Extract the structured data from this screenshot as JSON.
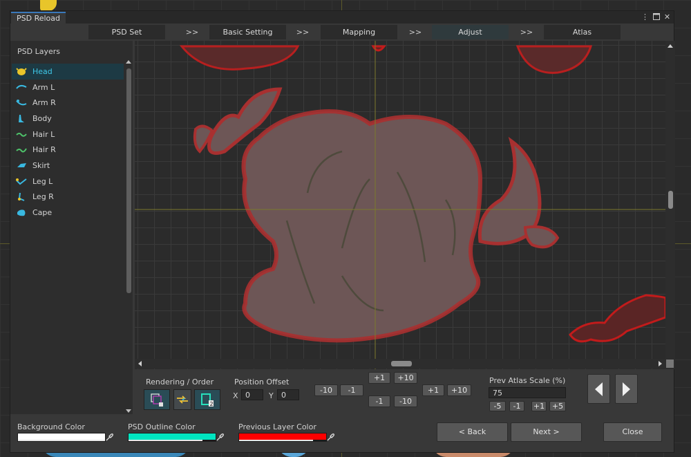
{
  "window": {
    "title": "PSD Reload"
  },
  "steps": [
    {
      "label": "PSD Set"
    },
    {
      "label": "Basic Setting"
    },
    {
      "label": "Mapping"
    },
    {
      "label": "Adjust",
      "active": true
    },
    {
      "label": "Atlas"
    }
  ],
  "step_separator": ">>",
  "layers_panel": {
    "title": "PSD Layers",
    "selected": "Head",
    "items": [
      {
        "label": "Head",
        "icon": "head-layer-icon",
        "color": "#e8c52a"
      },
      {
        "label": "Arm L",
        "icon": "arm-l-layer-icon",
        "color": "#39b8e0"
      },
      {
        "label": "Arm R",
        "icon": "arm-r-layer-icon",
        "color": "#39b8e0"
      },
      {
        "label": "Body",
        "icon": "body-layer-icon",
        "color": "#39b8e0"
      },
      {
        "label": "Hair L",
        "icon": "hair-l-layer-icon",
        "color": "#4ec26a"
      },
      {
        "label": "Hair R",
        "icon": "hair-r-layer-icon",
        "color": "#4ec26a"
      },
      {
        "label": "Skirt",
        "icon": "skirt-layer-icon",
        "color": "#39b8e0"
      },
      {
        "label": "Leg L",
        "icon": "leg-l-layer-icon",
        "color": "#e8c52a"
      },
      {
        "label": "Leg R",
        "icon": "leg-r-layer-icon",
        "color": "#e8c52a"
      },
      {
        "label": "Cape",
        "icon": "cape-layer-icon",
        "color": "#39b8e0"
      }
    ]
  },
  "controls": {
    "rendering_label": "Rendering / Order",
    "position_label": "Position Offset",
    "x_label": "X",
    "x_value": "0",
    "y_label": "Y",
    "y_value": "0",
    "pos_buttons": [
      "-10",
      "-1",
      "+1",
      "+10",
      "-1",
      "-10",
      "+1",
      "+10"
    ],
    "scale_label": "Prev Atlas Scale (%)",
    "scale_value": "75",
    "scale_buttons": [
      "-5",
      "-1",
      "+1",
      "+5"
    ]
  },
  "footer": {
    "background_color_label": "Background Color",
    "background_color": "#ffffff",
    "outline_color_label": "PSD Outline Color",
    "outline_color": "#00e5c0",
    "prev_layer_color_label": "Previous Layer Color",
    "prev_layer_color": "#ff0000",
    "back_label": "< Back",
    "next_label": "Next >",
    "close_label": "Close"
  }
}
